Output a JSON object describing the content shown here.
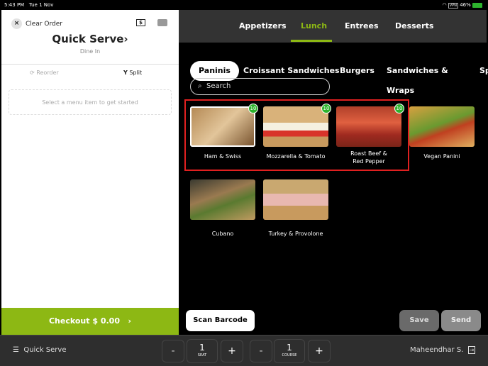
{
  "status": {
    "time": "5:43 PM",
    "date": "Tue 1 Nov",
    "vpn": "VPN",
    "battery": "46%"
  },
  "order": {
    "clear": "Clear Order",
    "title": "Quick Serve",
    "chevron": "›",
    "mode": "Dine In",
    "reorder": "Reorder",
    "split": "Split",
    "placeholder": "Select a menu item to get started",
    "checkout": "Checkout $ 0.00",
    "checkout_chevron": "›"
  },
  "menus": [
    "Appetizers",
    "Lunch",
    "Entrees",
    "Desserts"
  ],
  "active_menu": "Lunch",
  "categories": [
    "Paninis",
    "Croissant Sandwiches",
    "Burgers",
    "Sandwiches & Wraps",
    "Sp"
  ],
  "search": {
    "placeholder": "Search"
  },
  "items": [
    {
      "name": "Ham & Swiss",
      "badge": "10"
    },
    {
      "name": "Mozzarella & Tomato",
      "badge": "10"
    },
    {
      "name": "Roast Beef & Red Pepper",
      "badge": "10"
    },
    {
      "name": "Vegan Panini"
    },
    {
      "name": "Cubano"
    },
    {
      "name": "Turkey & Provolone"
    }
  ],
  "actions": {
    "scan": "Scan Barcode",
    "save": "Save",
    "send": "Send"
  },
  "bottom": {
    "menu": "Quick Serve",
    "minus": "-",
    "plus": "+",
    "seat": "1",
    "seat_label": "SEAT",
    "course": "1",
    "course_label": "COURSE",
    "user": "Maheendhar S."
  },
  "colors": {
    "accent": "#8db814",
    "highlight": "#e02020"
  }
}
